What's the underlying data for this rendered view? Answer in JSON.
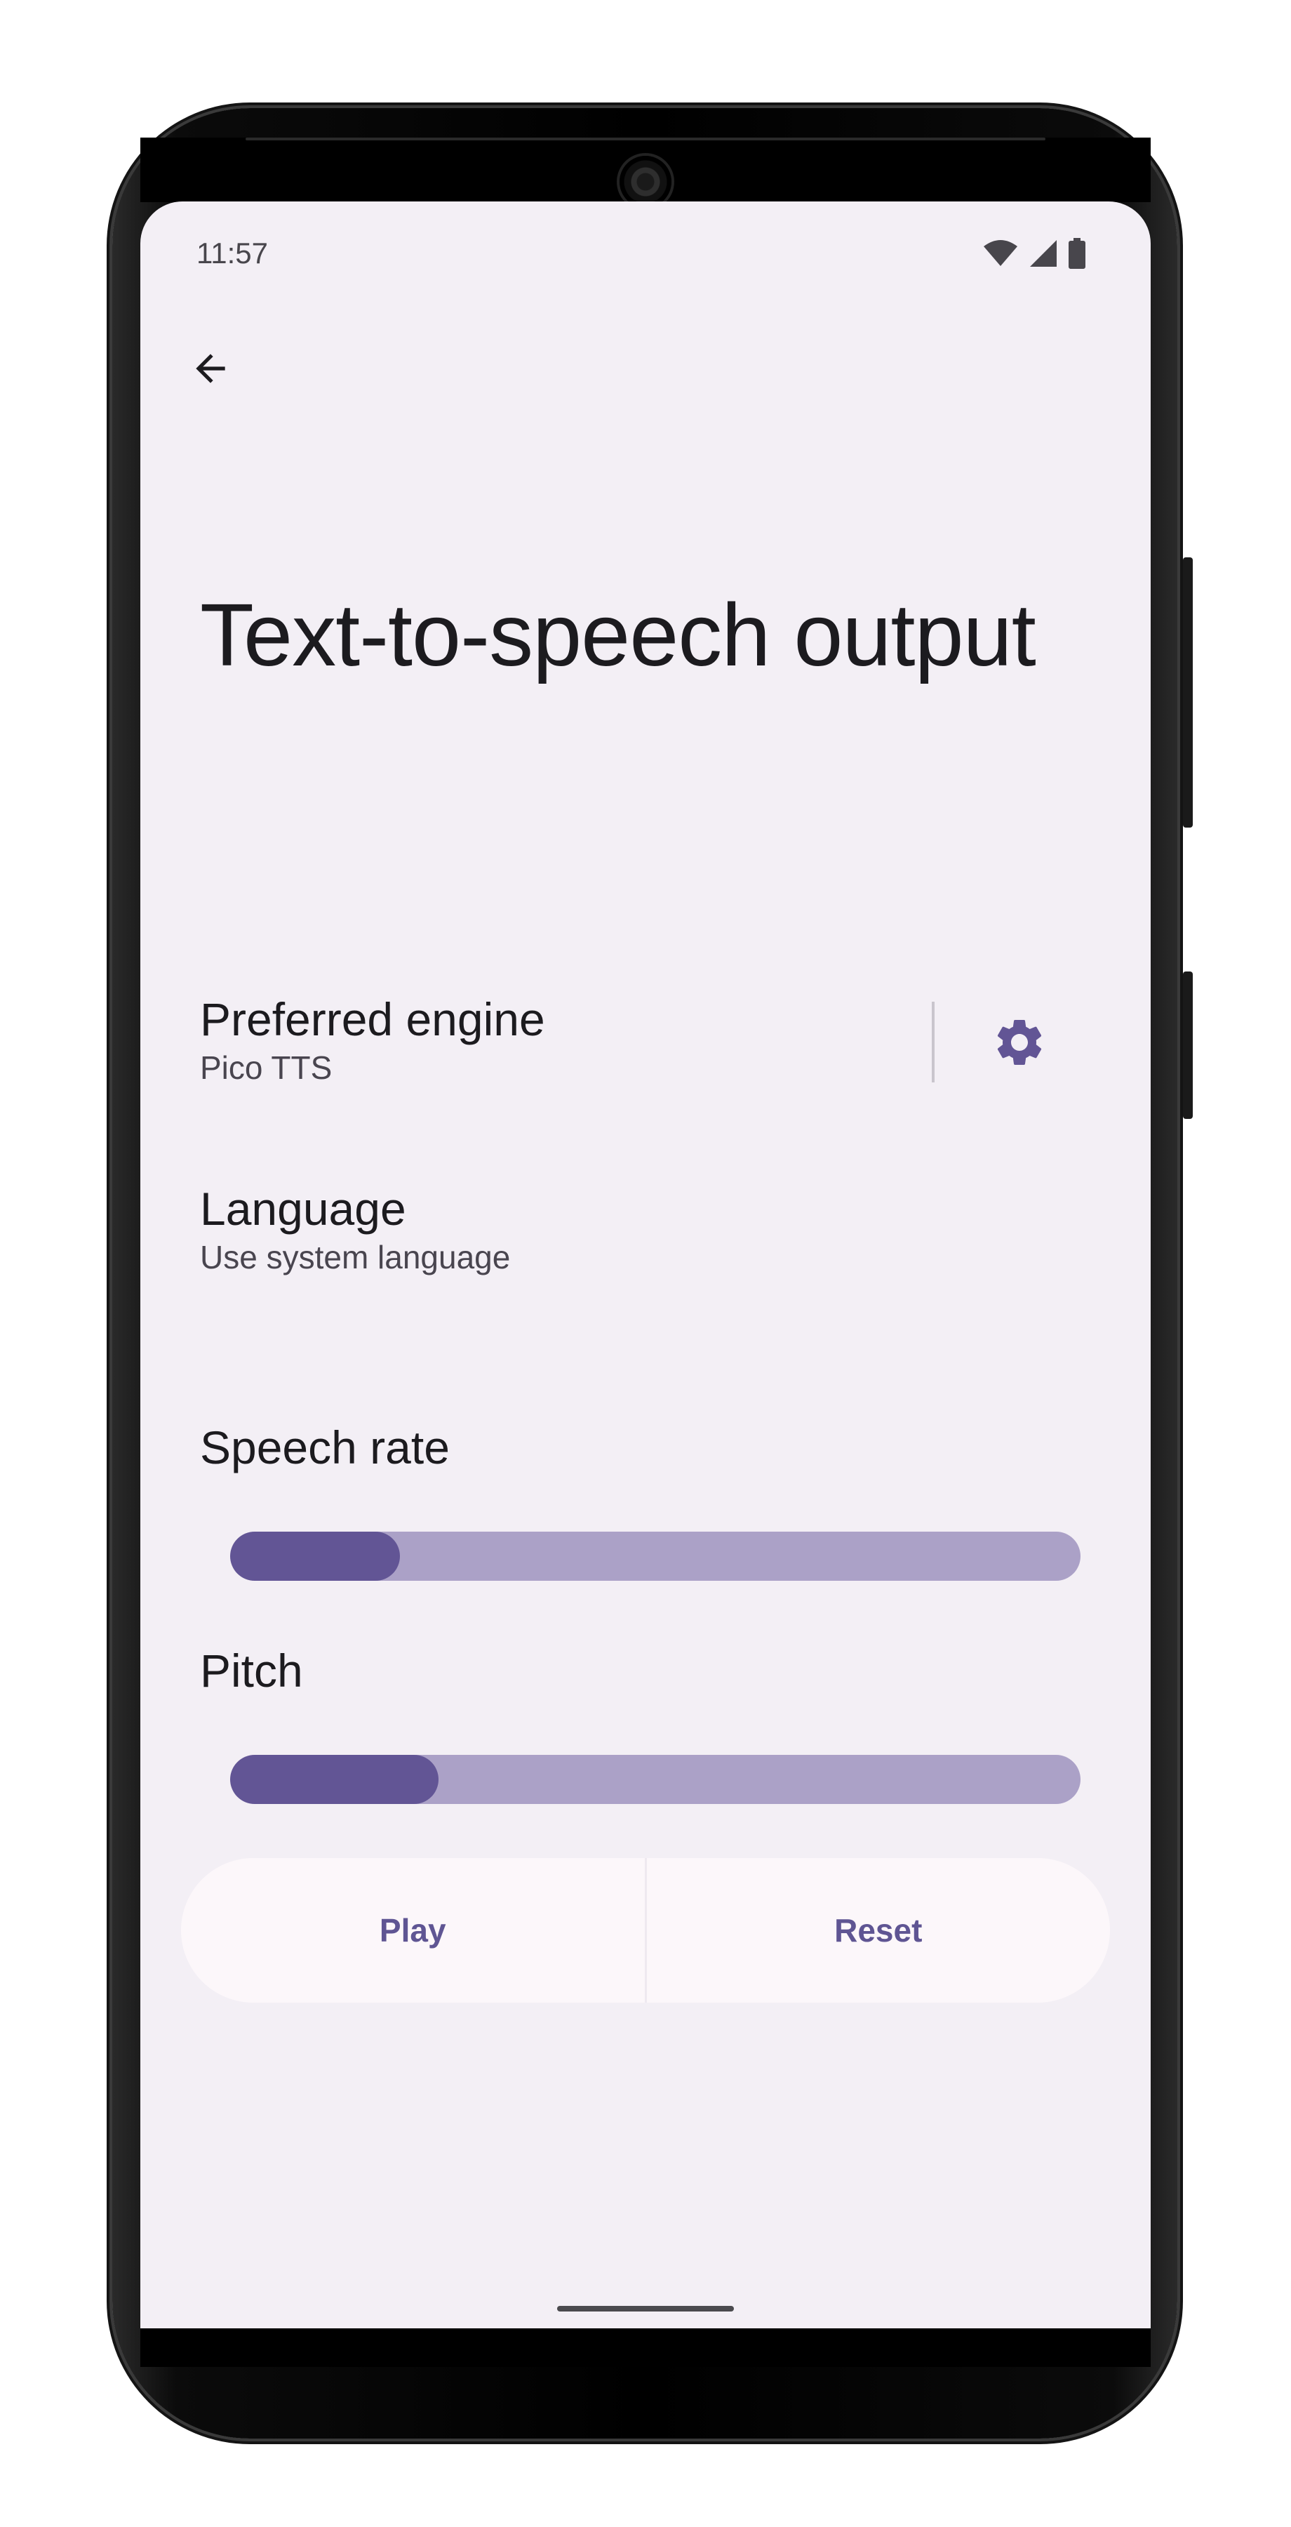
{
  "status_bar": {
    "time": "11:57",
    "icons": [
      "wifi-icon",
      "signal-icon",
      "battery-icon"
    ]
  },
  "toolbar": {
    "back_icon": "arrow-left-icon"
  },
  "page": {
    "title": "Text-to-speech output"
  },
  "preferred_engine": {
    "title": "Preferred engine",
    "summary": "Pico TTS",
    "settings_icon": "gear-icon"
  },
  "language": {
    "title": "Language",
    "summary": "Use system language"
  },
  "speech_rate": {
    "label": "Speech rate",
    "value_fraction": 0.2
  },
  "pitch": {
    "label": "Pitch",
    "value_fraction": 0.245
  },
  "actions": {
    "play_label": "Play",
    "reset_label": "Reset"
  },
  "colors": {
    "background": "#f3eff5",
    "accent": "#625595",
    "track": "#aba1c7",
    "button_surface": "#fcf7fa",
    "button_text": "#5f5593"
  }
}
